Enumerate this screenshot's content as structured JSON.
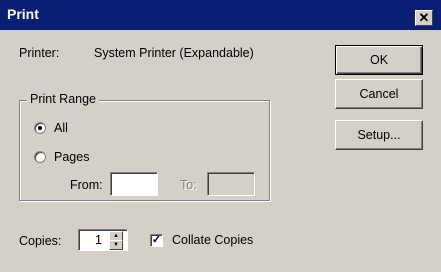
{
  "window": {
    "title": "Print",
    "close_glyph": "✕"
  },
  "printer": {
    "label": "Printer:",
    "value": "System Printer (Expandable)"
  },
  "buttons": {
    "ok": "OK",
    "cancel": "Cancel",
    "setup": "Setup..."
  },
  "print_range": {
    "title": "Print Range",
    "all_label": "All",
    "pages_label": "Pages",
    "from_label": "From:",
    "to_label": "To:",
    "selected": "All",
    "from_value": "",
    "to_value": ""
  },
  "copies": {
    "label": "Copies:",
    "value": "1"
  },
  "collate": {
    "label": "Collate Copies",
    "checked": true,
    "check_glyph": "✓"
  },
  "icons": {
    "close": "close-icon",
    "spin_up": "spin-up-icon",
    "spin_down": "spin-down-icon"
  },
  "colors": {
    "titlebar": "#0a1e74",
    "face": "#d4d0c8"
  }
}
